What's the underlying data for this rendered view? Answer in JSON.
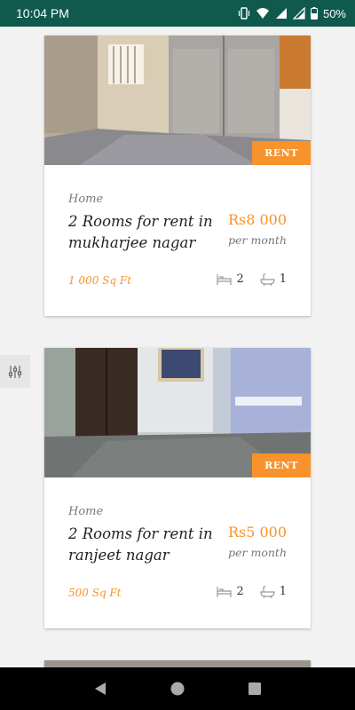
{
  "status_bar": {
    "time": "10:04 PM",
    "battery": "50%",
    "icons": [
      "vibrate-icon",
      "wifi-icon",
      "signal-icon",
      "signal-icon",
      "battery-icon"
    ]
  },
  "listings": [
    {
      "badge": "RENT",
      "category": "Home",
      "title": "2 Rooms for rent in mukharjee nagar",
      "price": "Rs8 000",
      "period": "per month",
      "area": "1 000 Sq Ft",
      "bedrooms": "2",
      "bathrooms": "1"
    },
    {
      "badge": "RENT",
      "category": "Home",
      "title": "2 Rooms for rent in ranjeet nagar",
      "price": "Rs5 000",
      "period": "per month",
      "area": "500 Sq Ft",
      "bedrooms": "2",
      "bathrooms": "1"
    }
  ],
  "colors": {
    "status_bar": "#0f5a4d",
    "accent": "#f7932a",
    "background": "#f2f2f2",
    "nav_bar": "#000000"
  },
  "nav": {
    "icons": [
      "back-icon",
      "home-icon",
      "recents-icon"
    ]
  }
}
